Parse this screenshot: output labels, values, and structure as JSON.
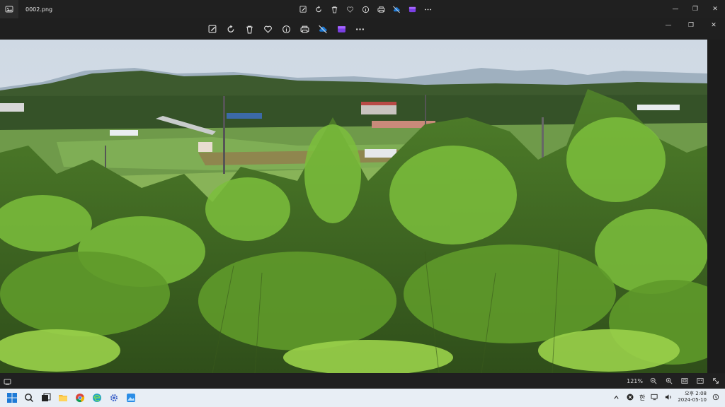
{
  "window": {
    "filename": "0002.png"
  },
  "title_tools": [
    "edit-image-icon",
    "rotate-icon",
    "delete-icon",
    "heart-icon",
    "info-icon",
    "print-icon",
    "cloud-off-icon",
    "clipchamp-icon",
    "more-icon"
  ],
  "toolbar": [
    "edit-image-icon",
    "rotate-icon",
    "delete-icon",
    "heart-icon",
    "info-icon",
    "print-icon",
    "cloud-off-icon",
    "clipchamp-icon",
    "more-icon"
  ],
  "status": {
    "zoom": "121%"
  },
  "taskbar": {
    "ime": "한",
    "time": "오후 2:08",
    "date": "2024-05-10"
  },
  "colors": {
    "title_bg": "#202020",
    "taskbar_bg": "#e8eef5",
    "accent_blue": "#1e7ad6"
  }
}
